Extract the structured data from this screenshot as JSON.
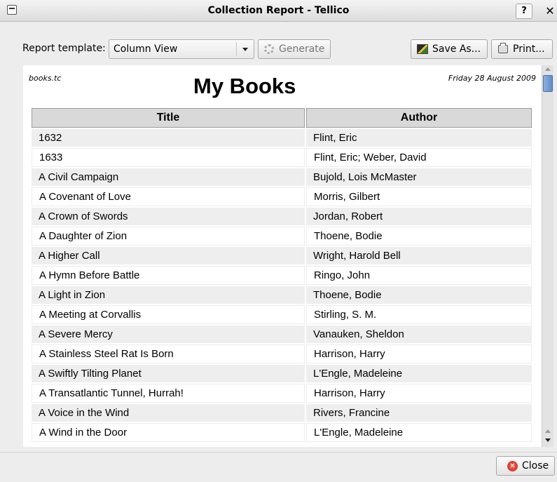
{
  "window": {
    "title": "Collection Report - Tellico",
    "help_label": "?",
    "close_glyph": "✕"
  },
  "toolbar": {
    "template_label": "Report template:",
    "template_value": "Column View",
    "generate_label": "Generate",
    "save_as_label": "Save As...",
    "print_label": "Print..."
  },
  "report": {
    "filename": "books.tc",
    "title": "My Books",
    "date": "Friday 28 August 2009",
    "columns": [
      "Title",
      "Author"
    ],
    "rows": [
      [
        "1632",
        "Flint, Eric"
      ],
      [
        "1633",
        "Flint, Eric; Weber, David"
      ],
      [
        "A Civil Campaign",
        "Bujold, Lois McMaster"
      ],
      [
        "A Covenant of Love",
        "Morris, Gilbert"
      ],
      [
        "A Crown of Swords",
        "Jordan, Robert"
      ],
      [
        "A Daughter of Zion",
        "Thoene, Bodie"
      ],
      [
        "A Higher Call",
        "Wright, Harold Bell"
      ],
      [
        "A Hymn Before Battle",
        "Ringo, John"
      ],
      [
        "A Light in Zion",
        "Thoene, Bodie"
      ],
      [
        "A Meeting at Corvallis",
        "Stirling, S. M."
      ],
      [
        "A Severe Mercy",
        "Vanauken, Sheldon"
      ],
      [
        "A Stainless Steel Rat Is Born",
        "Harrison, Harry"
      ],
      [
        "A Swiftly Tilting Planet",
        "L'Engle, Madeleine"
      ],
      [
        "A Transatlantic Tunnel, Hurrah!",
        "Harrison, Harry"
      ],
      [
        "A Voice in the Wind",
        "Rivers, Francine"
      ],
      [
        "A Wind in the Door",
        "L'Engle, Madeleine"
      ]
    ]
  },
  "footer": {
    "close_label": "Close"
  },
  "colors": {
    "accent": "#5f8ccc",
    "header_bg": "#d9d9d9",
    "row_alt_bg": "#eeeeee",
    "close_icon": "#c82418"
  },
  "icons": {
    "window_menu": "window-menu-icon",
    "generate": "gear-icon",
    "save": "save-icon",
    "print": "printer-icon",
    "close": "close-circle-icon"
  }
}
